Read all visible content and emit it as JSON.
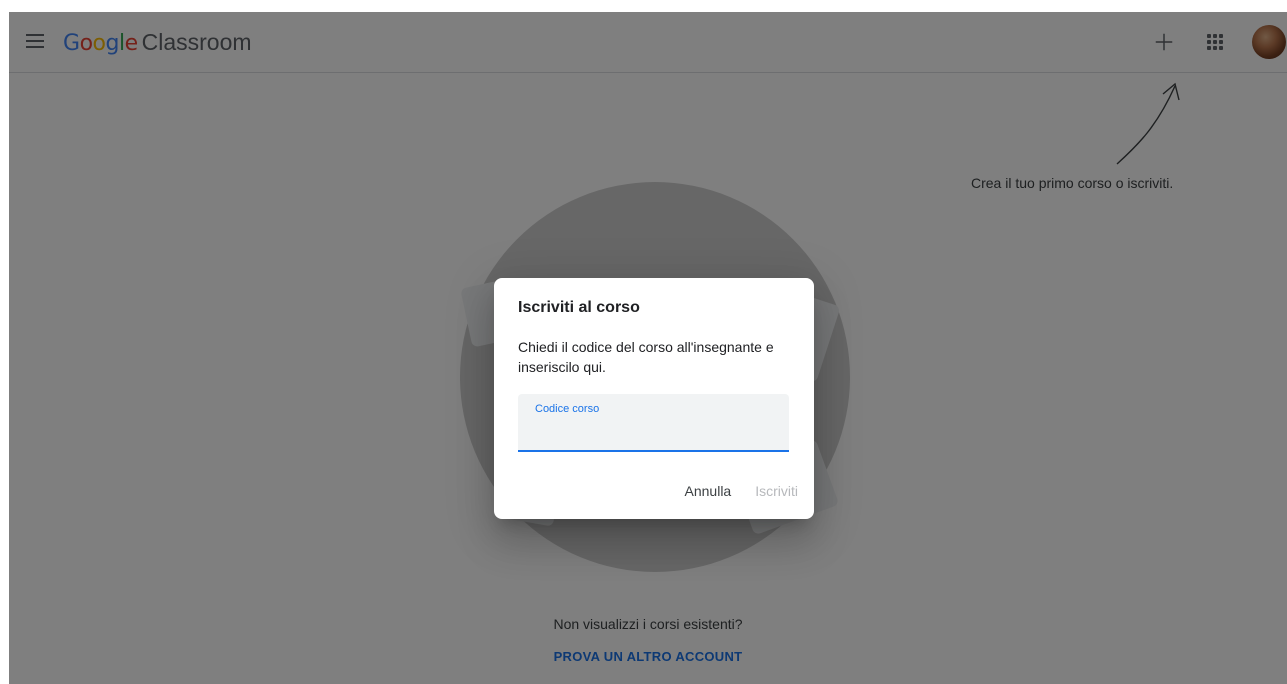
{
  "header": {
    "logo_google_letters": [
      {
        "char": "G",
        "color": "#4285f4"
      },
      {
        "char": "o",
        "color": "#ea4335"
      },
      {
        "char": "o",
        "color": "#fbbc04"
      },
      {
        "char": "g",
        "color": "#4285f4"
      },
      {
        "char": "l",
        "color": "#34a853"
      },
      {
        "char": "e",
        "color": "#ea4335"
      }
    ],
    "logo_product": "Classroom",
    "menu_icon": "hamburger-menu-icon",
    "create_icon": "plus-icon",
    "apps_icon": "google-apps-icon",
    "avatar_icon": "user-avatar"
  },
  "main": {
    "hint": "Crea il tuo primo corso o iscriviti.",
    "question": "Non visualizzi i corsi esistenti?",
    "try_other_account": "PROVA UN ALTRO ACCOUNT"
  },
  "dialog": {
    "title": "Iscriviti al corso",
    "body": "Chiedi il codice del corso all'insegnante e inseriscilo qui.",
    "field_label": "Codice corso",
    "field_value": "",
    "cancel": "Annulla",
    "join": "Iscriviti"
  },
  "colors": {
    "accent": "#1a73e8",
    "scrim": "rgba(0,0,0,0.5)"
  }
}
